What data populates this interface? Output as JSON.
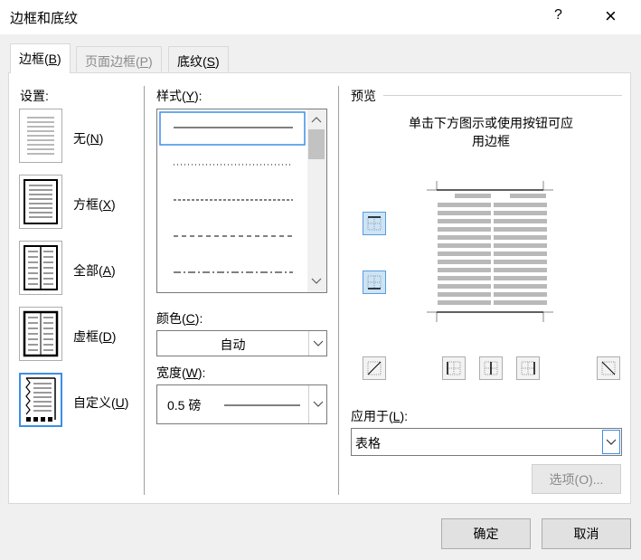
{
  "window": {
    "title": "边框和底纹",
    "help": "?",
    "close": "×"
  },
  "tabs": [
    {
      "label": "边框(B)",
      "accel": "B",
      "state": "active"
    },
    {
      "label": "页面边框(P)",
      "accel": "P",
      "state": "disabled"
    },
    {
      "label": "底纹(S)",
      "accel": "S",
      "state": "normal"
    }
  ],
  "settings": {
    "heading": "设置:",
    "items": [
      {
        "label": "无(N)",
        "accel": "N"
      },
      {
        "label": "方框(X)",
        "accel": "X"
      },
      {
        "label": "全部(A)",
        "accel": "A"
      },
      {
        "label": "虚框(D)",
        "accel": "D"
      },
      {
        "label": "自定义(U)",
        "accel": "U",
        "selected": true
      }
    ]
  },
  "style": {
    "label": "样式(Y):",
    "accel": "Y",
    "options": [
      "solid",
      "dotted",
      "dashed",
      "long-dashed",
      "dash-dot"
    ],
    "selected": "solid"
  },
  "color": {
    "label": "颜色(C):",
    "accel": "C",
    "value": "自动"
  },
  "width": {
    "label": "宽度(W):",
    "accel": "W",
    "value": "0.5 磅"
  },
  "preview": {
    "heading": "预览",
    "hint": "单击下方图示或使用按钮可应用边框"
  },
  "apply": {
    "label": "应用于(L):",
    "accel": "L",
    "value": "表格"
  },
  "options_button": {
    "label": "选项(O)...",
    "disabled": true
  },
  "footer": {
    "ok": "确定",
    "cancel": "取消"
  },
  "colors": {
    "accent": "#3d8ee6",
    "pressed": "#cce4f7",
    "preview_gray": "#b9b9b9"
  }
}
